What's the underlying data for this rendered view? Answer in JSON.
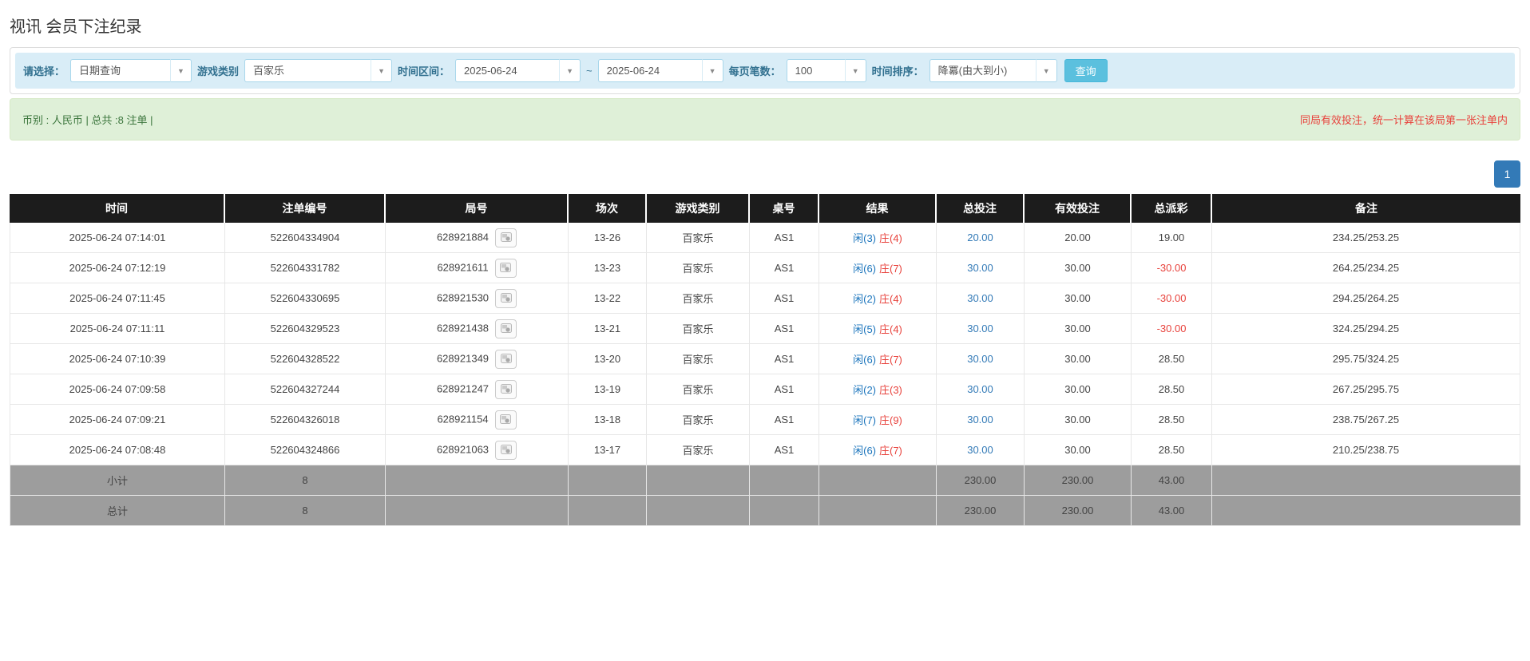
{
  "page_title": "视讯 会员下注纪录",
  "filters": {
    "query_type": {
      "label": "请选择：",
      "value": "日期查询"
    },
    "game_type": {
      "label": "游戏类别",
      "value": "百家乐"
    },
    "date_range": {
      "label": "时间区间：",
      "from": "2025-06-24",
      "separator": "~",
      "to": "2025-06-24"
    },
    "page_size": {
      "label": "每页笔数：",
      "value": "100"
    },
    "time_sort": {
      "label": "时间排序：",
      "value": "降冪(由大到小)"
    },
    "search_button": "查询"
  },
  "summary_bar": {
    "currency_info": "币别 : 人民币 | 总共 :8 注单 |",
    "notice": "同局有效投注，统一计算在该局第一张注单内"
  },
  "pagination": {
    "current_page": "1"
  },
  "table": {
    "headers": {
      "time": "时间",
      "bet_id": "注单编号",
      "round_id": "局号",
      "session": "场次",
      "game_type": "游戏类别",
      "table_no": "桌号",
      "result": "结果",
      "total_bet": "总投注",
      "valid_bet": "有效投注",
      "payout": "总派彩",
      "note": "备注"
    },
    "rows": [
      {
        "time": "2025-06-24 07:14:01",
        "bet_id": "522604334904",
        "round_id": "628921884",
        "session": "13-26",
        "game_type": "百家乐",
        "table_no": "AS1",
        "result_player": "闲(3)",
        "result_banker": "庄(4)",
        "total_bet": "20.00",
        "valid_bet": "20.00",
        "payout": "19.00",
        "payout_class": "pos",
        "note": "234.25/253.25"
      },
      {
        "time": "2025-06-24 07:12:19",
        "bet_id": "522604331782",
        "round_id": "628921611",
        "session": "13-23",
        "game_type": "百家乐",
        "table_no": "AS1",
        "result_player": "闲(6)",
        "result_banker": "庄(7)",
        "total_bet": "30.00",
        "valid_bet": "30.00",
        "payout": "-30.00",
        "payout_class": "neg",
        "note": "264.25/234.25"
      },
      {
        "time": "2025-06-24 07:11:45",
        "bet_id": "522604330695",
        "round_id": "628921530",
        "session": "13-22",
        "game_type": "百家乐",
        "table_no": "AS1",
        "result_player": "闲(2)",
        "result_banker": "庄(4)",
        "total_bet": "30.00",
        "valid_bet": "30.00",
        "payout": "-30.00",
        "payout_class": "neg",
        "note": "294.25/264.25"
      },
      {
        "time": "2025-06-24 07:11:11",
        "bet_id": "522604329523",
        "round_id": "628921438",
        "session": "13-21",
        "game_type": "百家乐",
        "table_no": "AS1",
        "result_player": "闲(5)",
        "result_banker": "庄(4)",
        "total_bet": "30.00",
        "valid_bet": "30.00",
        "payout": "-30.00",
        "payout_class": "neg",
        "note": "324.25/294.25"
      },
      {
        "time": "2025-06-24 07:10:39",
        "bet_id": "522604328522",
        "round_id": "628921349",
        "session": "13-20",
        "game_type": "百家乐",
        "table_no": "AS1",
        "result_player": "闲(6)",
        "result_banker": "庄(7)",
        "total_bet": "30.00",
        "valid_bet": "30.00",
        "payout": "28.50",
        "payout_class": "pos",
        "note": "295.75/324.25"
      },
      {
        "time": "2025-06-24 07:09:58",
        "bet_id": "522604327244",
        "round_id": "628921247",
        "session": "13-19",
        "game_type": "百家乐",
        "table_no": "AS1",
        "result_player": "闲(2)",
        "result_banker": "庄(3)",
        "total_bet": "30.00",
        "valid_bet": "30.00",
        "payout": "28.50",
        "payout_class": "pos",
        "note": "267.25/295.75"
      },
      {
        "time": "2025-06-24 07:09:21",
        "bet_id": "522604326018",
        "round_id": "628921154",
        "session": "13-18",
        "game_type": "百家乐",
        "table_no": "AS1",
        "result_player": "闲(7)",
        "result_banker": "庄(9)",
        "total_bet": "30.00",
        "valid_bet": "30.00",
        "payout": "28.50",
        "payout_class": "pos",
        "note": "238.75/267.25"
      },
      {
        "time": "2025-06-24 07:08:48",
        "bet_id": "522604324866",
        "round_id": "628921063",
        "session": "13-17",
        "game_type": "百家乐",
        "table_no": "AS1",
        "result_player": "闲(6)",
        "result_banker": "庄(7)",
        "total_bet": "30.00",
        "valid_bet": "30.00",
        "payout": "28.50",
        "payout_class": "pos",
        "note": "210.25/238.75"
      }
    ],
    "subtotal": {
      "label": "小计",
      "count": "8",
      "total_bet": "230.00",
      "valid_bet": "230.00",
      "payout": "43.00"
    },
    "total": {
      "label": "总计",
      "count": "8",
      "total_bet": "230.00",
      "valid_bet": "230.00",
      "payout": "43.00"
    }
  },
  "colors": {
    "accent_blue": "#337ab7",
    "info_bg": "#d9edf7",
    "info_text": "#31708f",
    "success_bg": "#dff0d8",
    "success_text": "#3c763d",
    "danger_red": "#e8423c",
    "header_bg": "#1c1c1c",
    "subtotal_bg": "#9d9d9d",
    "search_button_bg": "#5bc0de"
  }
}
